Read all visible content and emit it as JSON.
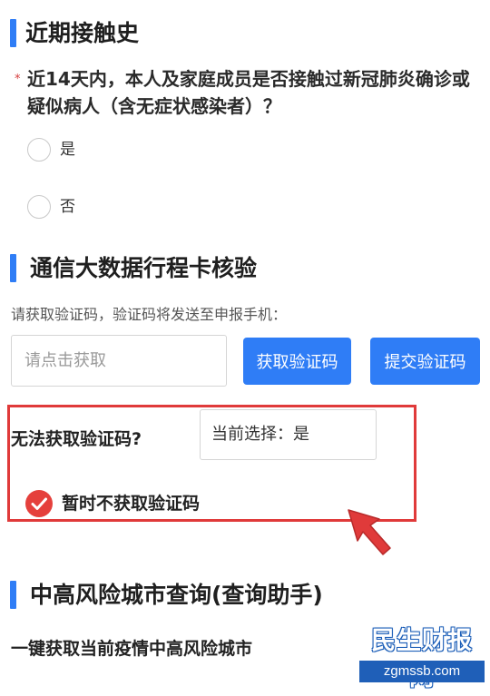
{
  "section_contact": {
    "title": "近期接触史"
  },
  "question": {
    "required_mark": "*",
    "text": "近14天内，本人及家庭成员是否接触过新冠肺炎确诊或疑似病人（含无症状感染者）？",
    "options": [
      {
        "label": "是",
        "selected": false
      },
      {
        "label": "否",
        "selected": false
      }
    ]
  },
  "section_itinerary": {
    "title": "通信大数据行程卡核验",
    "hint": "请获取验证码，验证码将发送至申报手机：",
    "code_input": {
      "placeholder": "请点击获取",
      "value": ""
    },
    "get_code_button": "获取验证码",
    "submit_code_button": "提交验证码",
    "no_code_label": "无法获取验证码?",
    "current_selection": "当前选择：是",
    "skip_checkbox": {
      "label": "暂时不获取验证码",
      "checked": true
    }
  },
  "section_risk": {
    "title": "中高风险城市查询(查询助手)",
    "body": "一键获取当前疫情中高风险城市"
  },
  "watermark": {
    "main": "民生财报网",
    "sub": "zgmssb.com"
  },
  "colors": {
    "accent": "#2f7df6",
    "highlight_red": "#e03a3a",
    "check_red": "#e5403c"
  },
  "icons": {
    "checkbox": "check-circle-icon",
    "arrow": "red-pointer-arrow-icon"
  }
}
